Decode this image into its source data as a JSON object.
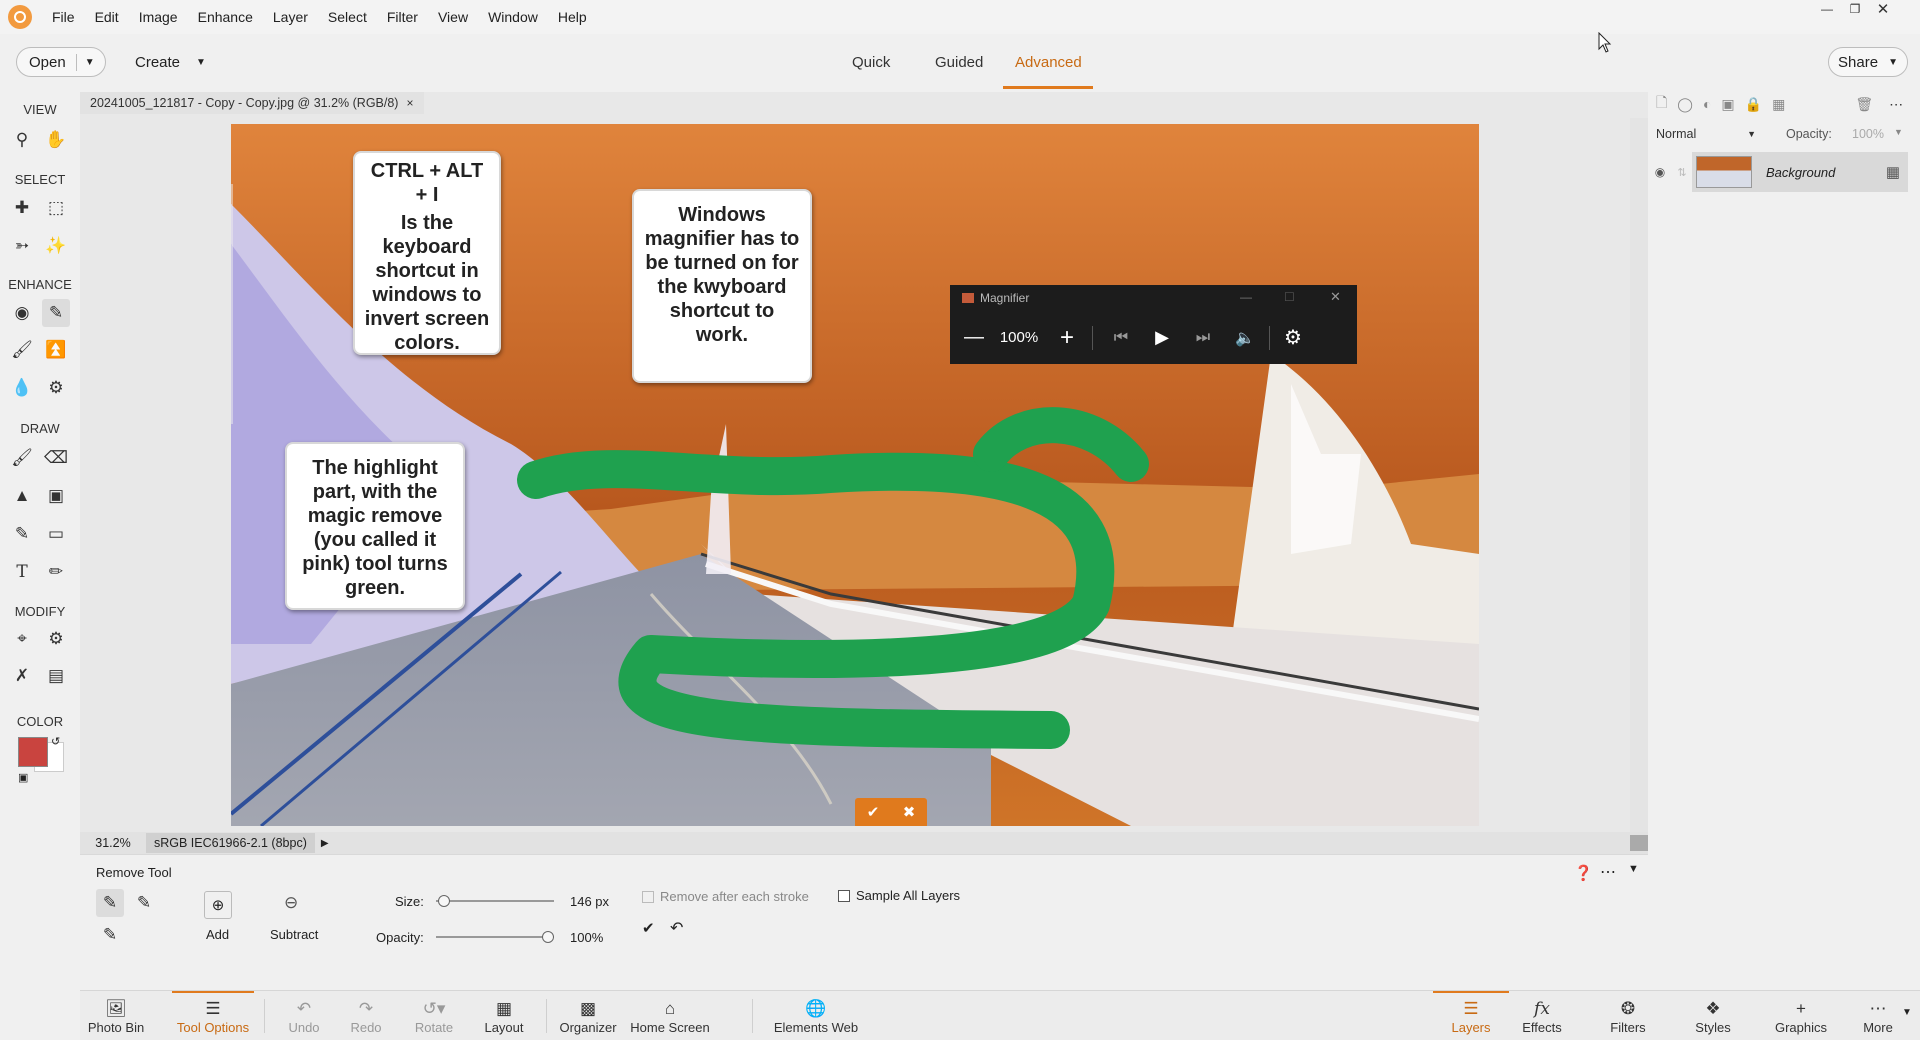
{
  "menubar": {
    "items": [
      "File",
      "Edit",
      "Image",
      "Enhance",
      "Layer",
      "Select",
      "Filter",
      "View",
      "Window",
      "Help"
    ]
  },
  "toolbar": {
    "open_label": "Open",
    "create_label": "Create",
    "share_label": "Share",
    "modes": [
      "Quick",
      "Guided",
      "Advanced"
    ],
    "active_mode": "Advanced"
  },
  "toolbox": {
    "sections": [
      "VIEW",
      "SELECT",
      "ENHANCE",
      "DRAW",
      "MODIFY",
      "COLOR"
    ],
    "foreground_color": "#c9443f",
    "background_color": "#ffffff"
  },
  "document": {
    "tab_title": "20241005_121817 - Copy - Copy.jpg @ 31.2% (RGB/8)",
    "zoom": "31.2%",
    "color_profile": "sRGB IEC61966-2.1 (8bpc)"
  },
  "canvas": {
    "callout_1_title": "CTRL + ALT + I",
    "callout_1_body": "Is the keyboard shortcut in windows to invert  screen colors.",
    "callout_2_body": "Windows magnifier has to be turned on for the kwyboard shortcut to work.",
    "callout_3_body": "The highlight part, with the magic remove (you called it pink) tool turns green."
  },
  "magnifier": {
    "title": "Magnifier",
    "zoom": "100%"
  },
  "layers": {
    "blend_mode": "Normal",
    "opacity_label": "Opacity:",
    "opacity_value": "100%",
    "layer_name": "Background"
  },
  "tool_options": {
    "tool_name": "Remove Tool",
    "add_label": "Add",
    "subtract_label": "Subtract",
    "size_label": "Size:",
    "size_value": "146 px",
    "size_level": 0.02,
    "opacity_label": "Opacity:",
    "opacity_value": "100%",
    "opacity_level": 1.0,
    "remove_after_label": "Remove after each stroke",
    "sample_all_label": "Sample All Layers"
  },
  "bottombar": {
    "photo_bin": "Photo Bin",
    "tool_options": "Tool Options",
    "undo": "Undo",
    "redo": "Redo",
    "rotate": "Rotate",
    "layout": "Layout",
    "organizer": "Organizer",
    "home_screen": "Home Screen",
    "elements_web": "Elements Web",
    "layers": "Layers",
    "effects": "Effects",
    "filters": "Filters",
    "styles": "Styles",
    "graphics": "Graphics",
    "more": "More"
  },
  "colors": {
    "accent": "#e07a1d",
    "highlight_stroke": "#1fa14f"
  }
}
